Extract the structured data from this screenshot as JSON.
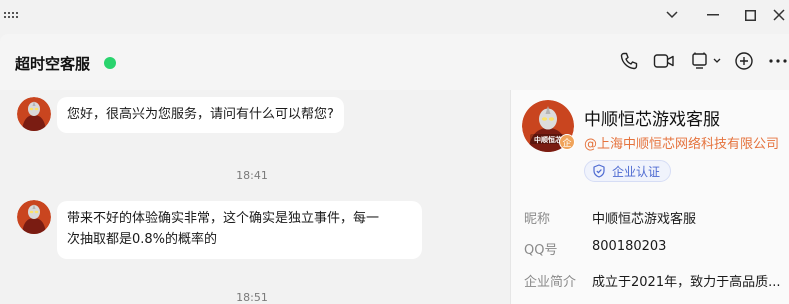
{
  "window": {
    "grip_icon": "drag-grip-icon",
    "minimize_icon": "chevron-down-icon",
    "restore_icon": "minimize-icon",
    "maximize_icon": "maximize-icon",
    "close_icon": "close-icon"
  },
  "header": {
    "title": "超时空客服",
    "online_color": "#2ad46e",
    "icons": [
      "phone-icon",
      "video-icon",
      "screen-share-icon",
      "add-icon",
      "more-icon"
    ]
  },
  "messages": [
    {
      "type": "msg",
      "text": "您好，很高兴为您服务，请问有什么可以帮您?"
    },
    {
      "type": "time",
      "text": "18:41"
    },
    {
      "type": "msg",
      "line1": "带来不好的体验确实非常，这个确实是独立事件，每一",
      "line2": "次抽取都是0.8%的概率的"
    },
    {
      "type": "time",
      "text": "18:51"
    }
  ],
  "avatar_text": "中顺恒芯",
  "profile": {
    "name": "中顺恒芯游戏客服",
    "company": "@上海中顺恒芯网络科技有限公司",
    "badge": "企",
    "cert": "企业认证",
    "rows": [
      {
        "label": "昵称",
        "value": "中顺恒芯游戏客服"
      },
      {
        "label": "QQ号",
        "value": "800180203"
      },
      {
        "label": "企业简介",
        "value": "成立于2021年，致力于高品质..."
      }
    ]
  },
  "colors": {
    "accent_orange": "#e5733d",
    "cert_blue": "#4d6ad1"
  }
}
